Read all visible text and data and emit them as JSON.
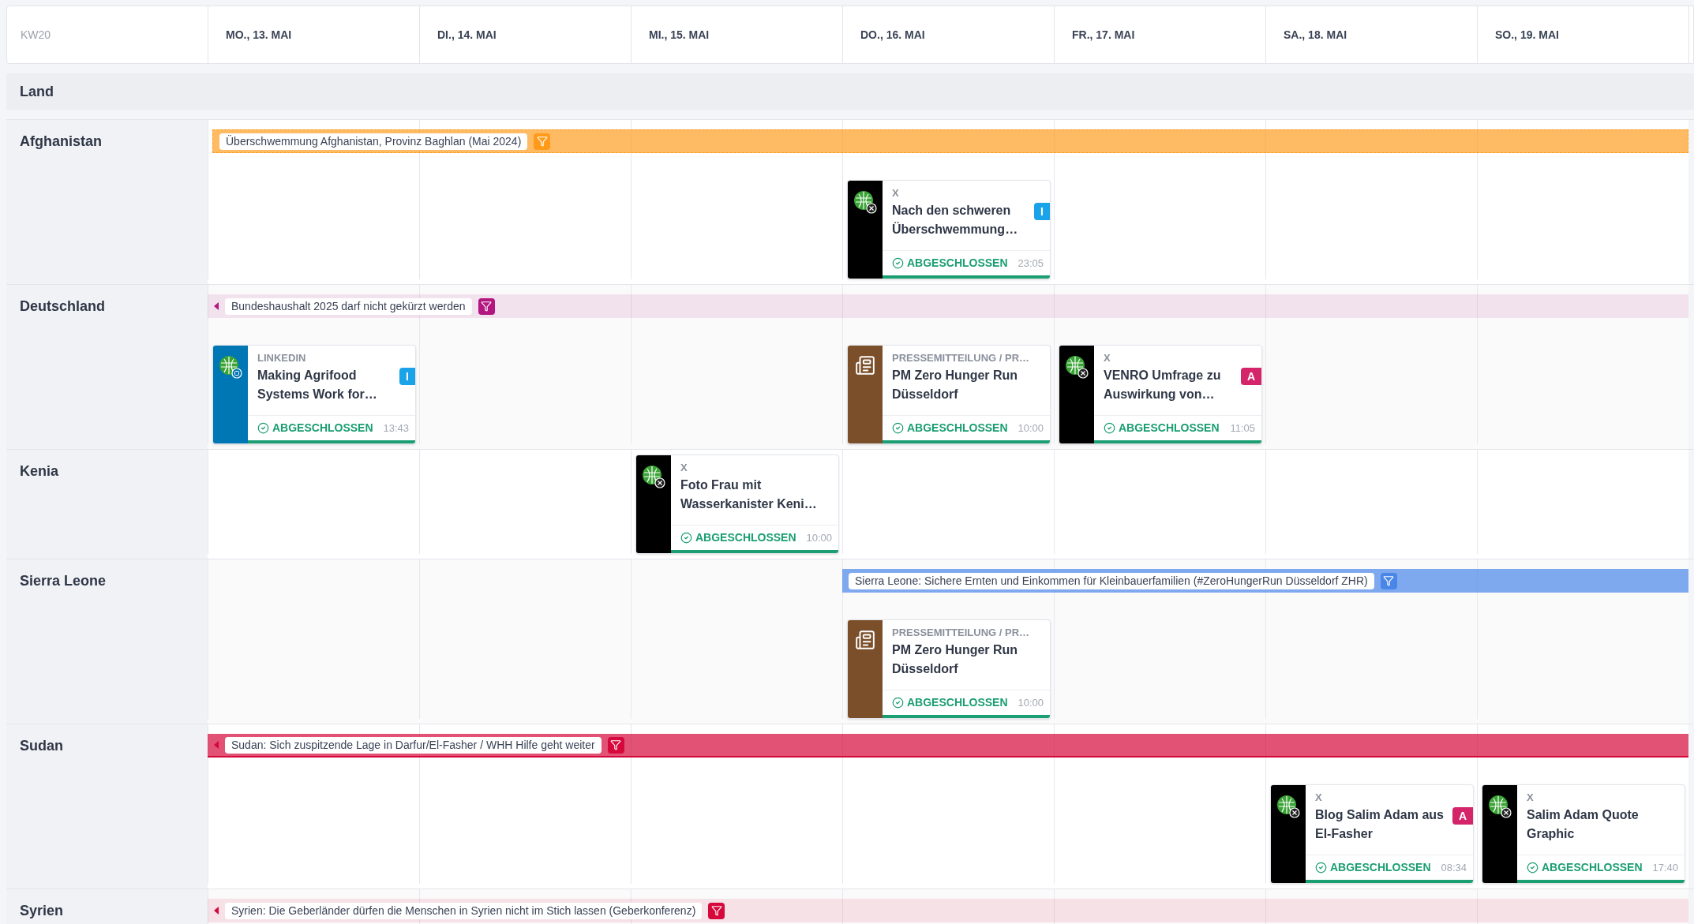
{
  "header": {
    "week": "KW20",
    "days": [
      "MO., 13. MAI",
      "DI., 14. MAI",
      "MI., 15. MAI",
      "DO., 16. MAI",
      "FR., 17. MAI",
      "SA., 18. MAI",
      "SO., 19. MAI"
    ]
  },
  "group_label": "Land",
  "rows": [
    {
      "name": "Afghanistan",
      "cells": [
        {
          "banner": {
            "label": "Überschwemmung Afghanistan, Provinz Baghlan (Mai 2024)",
            "kind": "dashed",
            "continues_left": false,
            "color": "#ff9a1a"
          }
        },
        null,
        null,
        {
          "card": {
            "kind": "x",
            "color": "#000000",
            "channel": "X",
            "title": "Nach den schweren Überschwemmung…",
            "badge": {
              "text": "I",
              "color": "#1aa3e8"
            },
            "status": "ABGESCHLOSSEN",
            "time": "23:05",
            "level": 1
          }
        },
        null,
        null,
        null
      ]
    },
    {
      "name": "Deutschland",
      "cells": [
        {
          "banner": {
            "label": "Bundeshaushalt 2025 darf nicht gekürzt werden",
            "kind": "pale",
            "continues_left": true,
            "color": "#b3177f"
          },
          "card": {
            "kind": "linkedin",
            "color": "#0077b5",
            "channel": "LINKEDIN",
            "title": "Making Agrifood Systems Work for…",
            "badge": {
              "text": "I",
              "color": "#1aa3e8"
            },
            "status": "ABGESCHLOSSEN",
            "time": "13:43",
            "level": 1
          }
        },
        null,
        null,
        {
          "card": {
            "kind": "press",
            "color": "#7b4f2a",
            "channel": "PRESSEMITTEILUNG / PR…",
            "title": "PM Zero Hunger Run Düsseldorf",
            "status": "ABGESCHLOSSEN",
            "time": "10:00",
            "level": 1
          }
        },
        {
          "card": {
            "kind": "x",
            "color": "#000000",
            "channel": "X",
            "title": "VENRO Umfrage zu Auswirkung von…",
            "badge": {
              "text": "A",
              "color": "#d4246a"
            },
            "status": "ABGESCHLOSSEN",
            "time": "11:05",
            "level": 1
          }
        },
        null,
        null
      ]
    },
    {
      "name": "Kenia",
      "cells": [
        null,
        null,
        {
          "card": {
            "kind": "x",
            "color": "#000000",
            "channel": "X",
            "title": "Foto Frau mit Wasserkanister Keni…",
            "status": "ABGESCHLOSSEN",
            "time": "10:00",
            "level": 1
          }
        },
        null,
        null,
        null,
        null
      ]
    },
    {
      "name": "Sierra Leone",
      "cells": [
        null,
        null,
        null,
        {
          "banner": {
            "label": "Sierra Leone: Sichere Ernten und Einkommen für Kleinbauerfamilien (#ZeroHungerRun Düsseldorf ZHR)",
            "kind": "strong",
            "continues_left": false,
            "color": "#4a86e8"
          },
          "card": {
            "kind": "press",
            "color": "#7b4f2a",
            "channel": "PRESSEMITTEILUNG / PR…",
            "title": "PM Zero Hunger Run Düsseldorf",
            "status": "ABGESCHLOSSEN",
            "time": "10:00",
            "level": 1
          }
        },
        null,
        null,
        null
      ]
    },
    {
      "name": "Sudan",
      "cells": [
        {
          "banner": {
            "label": "Sudan: Sich zuspitzende Lage in Darfur/El-Fasher / WHH Hilfe geht weiter",
            "kind": "strong",
            "continues_left": true,
            "color": "#d6083b"
          }
        },
        null,
        null,
        null,
        null,
        {
          "card": {
            "kind": "x",
            "color": "#000000",
            "channel": "X",
            "title": "Blog Salim Adam aus El-Fasher",
            "badge": {
              "text": "A",
              "color": "#d4246a"
            },
            "status": "ABGESCHLOSSEN",
            "time": "08:34",
            "level": 1
          }
        },
        {
          "card": {
            "kind": "x",
            "color": "#000000",
            "channel": "X",
            "title": "Salim Adam Quote Graphic",
            "status": "ABGESCHLOSSEN",
            "time": "17:40",
            "level": 1
          }
        }
      ]
    },
    {
      "name": "Syrien",
      "cells": [
        {
          "banner": {
            "label": "Syrien: Die Geberländer dürfen die Menschen in Syrien nicht im Stich lassen (Geberkonferenz)",
            "kind": "pale",
            "continues_left": true,
            "color": "#d6083b"
          }
        },
        null,
        null,
        null,
        null,
        null,
        null
      ]
    }
  ]
}
